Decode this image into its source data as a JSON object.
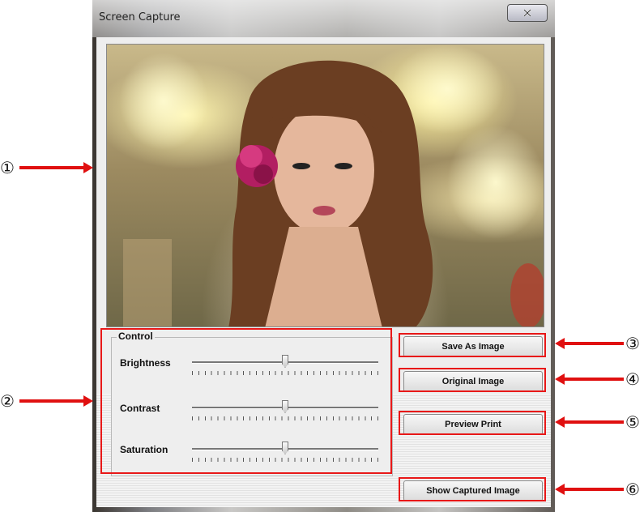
{
  "window": {
    "title": "Screen Capture",
    "close_icon": "close-icon"
  },
  "control": {
    "group_label": "Control",
    "sliders": [
      {
        "label": "Brightness",
        "value": 0.5
      },
      {
        "label": "Contrast",
        "value": 0.5
      },
      {
        "label": "Saturation",
        "value": 0.5
      }
    ]
  },
  "buttons": {
    "save": "Save As Image",
    "original": "Original Image",
    "preview": "Preview Print",
    "show": "Show Captured Image"
  },
  "annotations": [
    "①",
    "②",
    "③",
    "④",
    "⑤",
    "⑥"
  ],
  "colors": {
    "highlight": "#e81818",
    "arrow": "#e01010"
  }
}
